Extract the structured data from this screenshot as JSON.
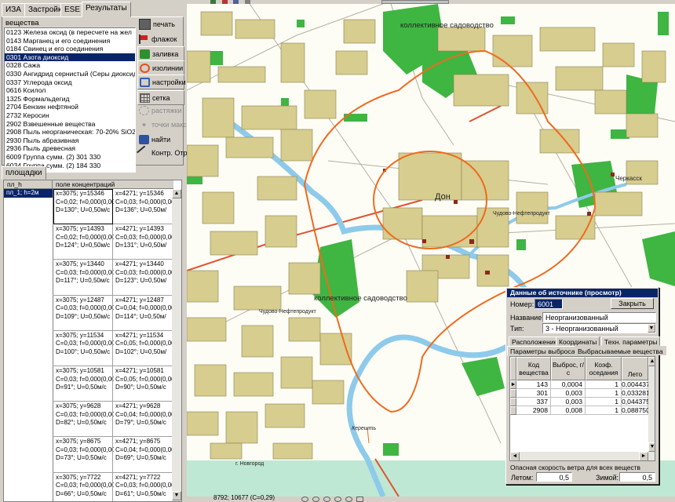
{
  "left_tabs": [
    "ИЗА",
    "Застройка",
    "ESE",
    "Результаты"
  ],
  "substances_label": "вещества",
  "substances": [
    "0123 Железа оксид (в пересчете на жел",
    "0143 Марганец и его соединения",
    "0184 Свинец и его соединения",
    "0301 Азота диоксид",
    "0328 Сажа",
    "0330 Ангидрид сернистый (Серы диоксид",
    "0337 Углерода оксид",
    "0616 Ксилол",
    "1325 Формальдегид",
    "2704 Бензин нефтяной",
    "2732 Керосин",
    "2902 Взвешенные вещества",
    "2908 Пыль неорганическая: 70-20% SiO2",
    "2930 Пыль абразивная",
    "2936 Пыль древесная",
    "6009 Группа сумм. (2) 301 330",
    "6034 Группа сумм. (2) 184 330"
  ],
  "selected_substance_index": 3,
  "tools": [
    {
      "label": "печать",
      "icon": "printer-icon",
      "boxed": false,
      "disabled": false
    },
    {
      "label": "флажок",
      "icon": "flag-icon",
      "boxed": false,
      "disabled": false
    },
    {
      "label": "заливка",
      "icon": "fill-icon",
      "boxed": true,
      "disabled": false
    },
    {
      "label": "изолинии",
      "icon": "isolines-icon",
      "boxed": true,
      "disabled": false
    },
    {
      "label": "настройки",
      "icon": "settings-icon",
      "boxed": true,
      "disabled": false
    },
    {
      "label": "сетка",
      "icon": "grid-icon",
      "boxed": true,
      "disabled": false
    },
    {
      "label": "растяжки",
      "icon": "stretch-icon",
      "boxed": false,
      "disabled": true
    },
    {
      "label": "точки макс",
      "icon": "max-points-icon",
      "boxed": false,
      "disabled": true
    },
    {
      "label": "найти",
      "icon": "find-icon",
      "boxed": false,
      "disabled": false
    },
    {
      "label": "Контр. Отр",
      "icon": "control-icon",
      "boxed": false,
      "disabled": false
    }
  ],
  "areas_tab": "площадки",
  "grid": {
    "col1_header": "пл_h",
    "col2_header": "поле концентраций",
    "col1_value": "пл_1; h=2м",
    "cells": [
      [
        "x=3075; y=15346\nC=0,02; f=0,000(0,000)\nD=130°; U=0,50м/с",
        "x=4271; y=15346\nC=0,03; f=0,000(0,000\nD=136°; U=0,50м/"
      ],
      [
        "x=3075; y=14393\nC=0,02; f=0,000(0,000)\nD=124°; U=0,50м/с",
        "x=4271; y=14393\nC=0,03; f=0,000(0,000\nD=131°; U=0,50м/"
      ],
      [
        "x=3075; y=13440\nC=0,03; f=0,000(0,000)\nD=117°; U=0,50м/с",
        "x=4271; y=13440\nC=0,03; f=0,000(0,000\nD=123°; U=0,50м/"
      ],
      [
        "x=3075; y=12487\nC=0,03; f=0,000(0,000)\nD=109°; U=0,50м/с",
        "x=4271; y=12487\nC=0,04; f=0,000(0,000\nD=114°; U=0,50м/"
      ],
      [
        "x=3075; y=11534\nC=0,03; f=0,000(0,000)\nD=100°; U=0,50м/с",
        "x=4271; y=11534\nC=0,05; f=0,000(0,000\nD=102°; U=0,50м/"
      ],
      [
        "x=3075; y=10581\nC=0,03; f=0,000(0,000)\nD=91°; U=0,50м/с",
        "x=4271; y=10581\nC=0,05; f=0,000(0,000\nD=90°; U=0,50м/с"
      ],
      [
        "x=3075; y=9628\nC=0,03; f=0,000(0,000)\nD=82°; U=0,50м/с",
        "x=4271; y=9628\nC=0,04; f=0,000(0,000\nD=79°; U=0,50м/с"
      ],
      [
        "x=3075; y=8675\nC=0,03; f=0,000(0,000)\nD=73°; U=0,50м/с",
        "x=4271; y=8675\nC=0,04; f=0,000(0,000\nD=69°; U=0,50м/с"
      ],
      [
        "x=3075; y=7722\nC=0,03; f=0,000(0,000)\nD=66°; U=0,50м/с",
        "x=4271; y=7722\nC=0,03; f=0,000(0,000\nD=61°; U=0,50м/с"
      ]
    ]
  },
  "status_coords": "8792; 10677 (C=0,29)",
  "map_labels": {
    "garden_top": "коллективное садоводство",
    "garden_bottom": "коллективное садоводство",
    "town": "Дон",
    "settlement": "Черкасск",
    "village1": "Чудово-Нефтепродукт",
    "village2": "Чудово-Нефтепродукт",
    "novgorod": "г. Новгород",
    "river": "Керешть"
  },
  "dialog": {
    "title": "Данные об источнике (просмотр)",
    "number_label": "Номер:",
    "number_value": "6001",
    "close_label": "Закрыть",
    "name_label": "Название:",
    "name_value": "Неорганизованный",
    "type_label": "Тип:",
    "type_value": "3 - Неорганизованный",
    "tabs": [
      "Расположение",
      "Координаты",
      "Техн. параметры"
    ],
    "tabs2": [
      "Параметры выброса",
      "Выбрасываемые вещества"
    ],
    "table": {
      "headers": [
        "Код вещества",
        "Выброс, г/с",
        "Коэф. оседания",
        "Лето"
      ],
      "rows": [
        [
          "143",
          "0,0004",
          "1",
          "0,004437"
        ],
        [
          "301",
          "0,003",
          "1",
          "0,033281"
        ],
        [
          "337",
          "0,003",
          "1",
          "0,044375"
        ],
        [
          "2908",
          "0,008",
          "1",
          "0,088750"
        ]
      ]
    },
    "wind_label": "Опасная скорость ветра для всех веществ",
    "summer_label": "Летом:",
    "summer_value": "0,5",
    "winter_label": "Зимой:",
    "winter_value": "0,5"
  },
  "colors": {
    "selection": "#0a246a",
    "dialog_title": "#0a246a",
    "building": "#d6cd8e",
    "park": "#3fb542",
    "river": "#8ecaea",
    "isoline": "#ef6a1e",
    "road": "#e0522f",
    "bottom_band": "#bfe8d4"
  }
}
